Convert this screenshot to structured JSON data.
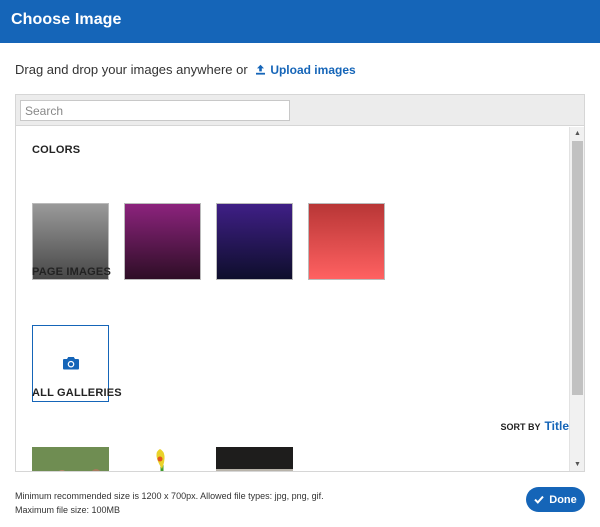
{
  "dialog": {
    "title": "Choose Image"
  },
  "instructions": {
    "text": "Drag and drop your images anywhere or",
    "upload_link": "Upload images"
  },
  "search": {
    "placeholder": "Search",
    "value": ""
  },
  "sections": {
    "colors": {
      "heading": "COLORS",
      "swatches": [
        {
          "name": "gray",
          "top": "#9a9a9a",
          "bottom": "#474747"
        },
        {
          "name": "purple",
          "top": "#8c237d",
          "bottom": "#2e0e26"
        },
        {
          "name": "indigo",
          "top": "#3f1f86",
          "bottom": "#0e0e2c"
        },
        {
          "name": "red",
          "top": "#b83636",
          "bottom": "#ff6161"
        }
      ]
    },
    "page_images": {
      "heading": "PAGE IMAGES",
      "upload_icon": "camera-icon"
    },
    "all_galleries": {
      "heading": "ALL GALLERIES",
      "sort_label": "SORT BY",
      "sort_value": "Title"
    }
  },
  "footer": {
    "note": "Minimum recommended size is 1200 x 700px. Allowed file types: jpg, png, gif. Maximum file size: 100MB",
    "done_label": "Done"
  },
  "colors": {
    "accent": "#1565b8"
  }
}
